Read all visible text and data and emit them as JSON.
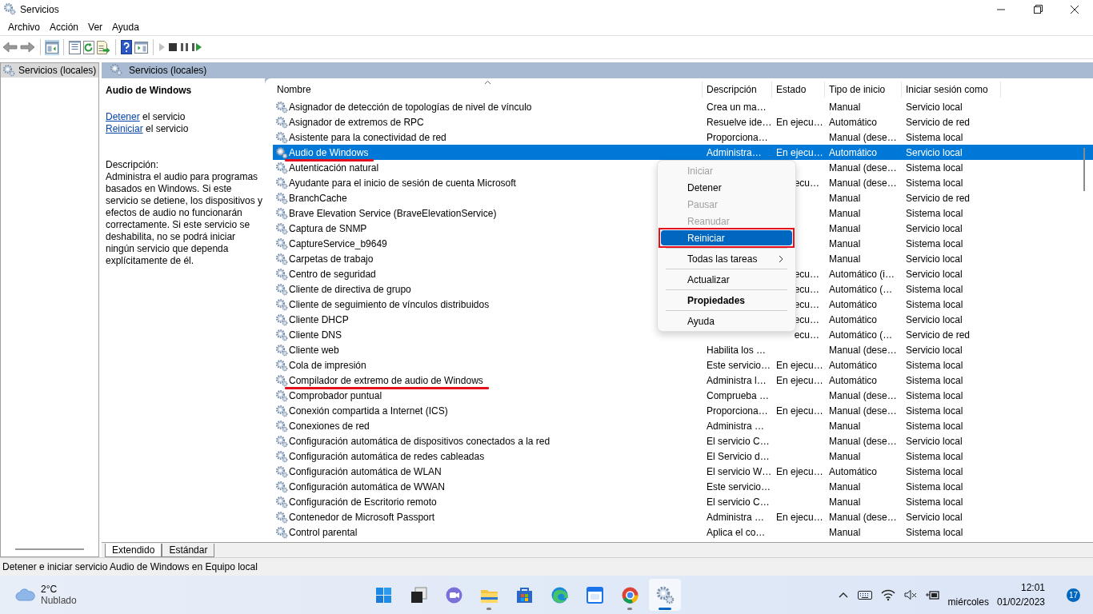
{
  "window": {
    "title": "Servicios"
  },
  "menu": [
    "Archivo",
    "Acción",
    "Ver",
    "Ayuda"
  ],
  "toolbar": [
    {
      "kind": "back",
      "disabled": false,
      "pressed": false
    },
    {
      "kind": "forward",
      "disabled": false,
      "pressed": false
    },
    {
      "kind": "separator"
    },
    {
      "kind": "tree",
      "disabled": false,
      "pressed": true
    },
    {
      "kind": "separator"
    },
    {
      "kind": "properties",
      "disabled": false,
      "pressed": false
    },
    {
      "kind": "refresh",
      "disabled": false,
      "pressed": false
    },
    {
      "kind": "export",
      "disabled": false,
      "pressed": false
    },
    {
      "kind": "separator"
    },
    {
      "kind": "help",
      "disabled": false,
      "pressed": false
    },
    {
      "kind": "actionpane",
      "disabled": false,
      "pressed": false
    },
    {
      "kind": "separator"
    },
    {
      "kind": "play",
      "disabled": true,
      "pressed": false
    },
    {
      "kind": "stop",
      "disabled": false,
      "pressed": false
    },
    {
      "kind": "pause",
      "disabled": false,
      "pressed": false
    },
    {
      "kind": "restart",
      "disabled": false,
      "pressed": false
    }
  ],
  "tree": [
    {
      "label": "Servicios (locales)",
      "selected": true
    }
  ],
  "pane_header": "Servicios (locales)",
  "details": {
    "title": "Audio de Windows",
    "actions": [
      {
        "link": "Detener",
        "text": "el servicio"
      },
      {
        "link": "Reiniciar",
        "text": "el servicio"
      }
    ],
    "description_label": "Descripción:",
    "description": "Administra el audio para programas basados en Windows. Si este servicio se detiene, los dispositivos y efectos de audio no funcionarán correctamente. Si este servicio se deshabilita, no se podrá iniciar ningún servicio que dependa explícitamente de él."
  },
  "table": {
    "columns": [
      {
        "label": "Nombre",
        "sorted": true
      },
      {
        "label": "Descripción",
        "sorted": false
      },
      {
        "label": "Estado",
        "sorted": false
      },
      {
        "label": "Tipo de inicio",
        "sorted": false
      },
      {
        "label": "Iniciar sesión como",
        "sorted": false
      }
    ],
    "rows": [
      {
        "name": "Asignador de detección de topologías de nivel de vínculo",
        "description": "Crea un ma…",
        "startup_type": "Manual",
        "log_on_as": "Servicio local",
        "selected": false,
        "underlined": false,
        "status_covered": false
      },
      {
        "name": "Asignador de extremos de RPC",
        "description": "Resuelve ide…",
        "status": "En ejecu…",
        "startup_type": "Automático",
        "log_on_as": "Servicio de red",
        "selected": false,
        "underlined": false,
        "status_covered": false
      },
      {
        "name": "Asistente para la conectividad de red",
        "description": "Proporciona…",
        "startup_type": "Manual (dese…",
        "log_on_as": "Sistema local",
        "selected": false,
        "underlined": false,
        "status_covered": false
      },
      {
        "name": "Audio de Windows",
        "description": "Administra…",
        "status": "En ejecu…",
        "startup_type": "Automático",
        "log_on_as": "Servicio local",
        "selected": true,
        "underlined": true,
        "status_covered": false
      },
      {
        "name": "Autenticación natural",
        "startup_type": "Manual (dese…",
        "log_on_as": "Sistema local",
        "selected": false,
        "underlined": false,
        "status_covered": false
      },
      {
        "name": "Ayudante para el inicio de sesión de cuenta Microsoft",
        "status": "ecu…",
        "startup_type": "Manual (dese…",
        "log_on_as": "Sistema local",
        "selected": false,
        "underlined": false,
        "status_covered": true
      },
      {
        "name": "BranchCache",
        "startup_type": "Manual",
        "log_on_as": "Servicio de red",
        "selected": false,
        "underlined": false,
        "status_covered": false
      },
      {
        "name": "Brave Elevation Service (BraveElevationService)",
        "startup_type": "Manual",
        "log_on_as": "Sistema local",
        "selected": false,
        "underlined": false,
        "status_covered": false
      },
      {
        "name": "Captura de SNMP",
        "startup_type": "Manual",
        "log_on_as": "Servicio local",
        "selected": false,
        "underlined": false,
        "status_covered": false
      },
      {
        "name": "CaptureService_b9649",
        "startup_type": "Manual",
        "log_on_as": "Sistema local",
        "selected": false,
        "underlined": false,
        "status_covered": false
      },
      {
        "name": "Carpetas de trabajo",
        "startup_type": "Manual",
        "log_on_as": "Servicio local",
        "selected": false,
        "underlined": false,
        "status_covered": false
      },
      {
        "name": "Centro de seguridad",
        "status": "ecu…",
        "startup_type": "Automático (i…",
        "log_on_as": "Servicio local",
        "selected": false,
        "underlined": false,
        "status_covered": true
      },
      {
        "name": "Cliente de directiva de grupo",
        "status": "ecu…",
        "startup_type": "Automático (…",
        "log_on_as": "Sistema local",
        "selected": false,
        "underlined": false,
        "status_covered": true
      },
      {
        "name": "Cliente de seguimiento de vínculos distribuidos",
        "status": "ecu…",
        "startup_type": "Automático",
        "log_on_as": "Sistema local",
        "selected": false,
        "underlined": false,
        "status_covered": true
      },
      {
        "name": "Cliente DHCP",
        "status": "ecu…",
        "startup_type": "Automático",
        "log_on_as": "Servicio local",
        "selected": false,
        "underlined": false,
        "status_covered": true
      },
      {
        "name": "Cliente DNS",
        "status": "ecu…",
        "startup_type": "Automático (…",
        "log_on_as": "Servicio de red",
        "selected": false,
        "underlined": false,
        "status_covered": true
      },
      {
        "name": "Cliente web",
        "description": "Habilita los …",
        "startup_type": "Manual (dese…",
        "log_on_as": "Servicio local",
        "selected": false,
        "underlined": false,
        "status_covered": false
      },
      {
        "name": "Cola de impresión",
        "description": "Este servicio…",
        "status": "En ejecu…",
        "startup_type": "Automático",
        "log_on_as": "Sistema local",
        "selected": false,
        "underlined": false,
        "status_covered": false
      },
      {
        "name": "Compilador de extremo de audio de Windows",
        "description": "Administra l…",
        "status": "En ejecu…",
        "startup_type": "Automático",
        "log_on_as": "Sistema local",
        "selected": false,
        "underlined": true,
        "status_covered": false
      },
      {
        "name": "Comprobador puntual",
        "description": "Comprueba …",
        "startup_type": "Manual (dese…",
        "log_on_as": "Sistema local",
        "selected": false,
        "underlined": false,
        "status_covered": false
      },
      {
        "name": "Conexión compartida a Internet (ICS)",
        "description": "Proporciona…",
        "status": "En ejecu…",
        "startup_type": "Manual (dese…",
        "log_on_as": "Sistema local",
        "selected": false,
        "underlined": false,
        "status_covered": false
      },
      {
        "name": "Conexiones de red",
        "description": "Administra …",
        "startup_type": "Manual",
        "log_on_as": "Sistema local",
        "selected": false,
        "underlined": false,
        "status_covered": false
      },
      {
        "name": "Configuración automática de dispositivos conectados a la red",
        "description": "El servicio C…",
        "startup_type": "Manual (dese…",
        "log_on_as": "Servicio local",
        "selected": false,
        "underlined": false,
        "status_covered": false
      },
      {
        "name": "Configuración automática de redes cableadas",
        "description": "El Servicio d…",
        "startup_type": "Manual",
        "log_on_as": "Sistema local",
        "selected": false,
        "underlined": false,
        "status_covered": false
      },
      {
        "name": "Configuración automática de WLAN",
        "description": "El servicio W…",
        "status": "En ejecu…",
        "startup_type": "Automático",
        "log_on_as": "Sistema local",
        "selected": false,
        "underlined": false,
        "status_covered": false
      },
      {
        "name": "Configuración automática de WWAN",
        "description": "Este servicio…",
        "startup_type": "Manual",
        "log_on_as": "Sistema local",
        "selected": false,
        "underlined": false,
        "status_covered": false
      },
      {
        "name": "Configuración de Escritorio remoto",
        "description": "El servicio C…",
        "startup_type": "Manual",
        "log_on_as": "Sistema local",
        "selected": false,
        "underlined": false,
        "status_covered": false
      },
      {
        "name": "Contenedor de Microsoft Passport",
        "description": "Administra …",
        "status": "En ejecu…",
        "startup_type": "Manual (dese…",
        "log_on_as": "Servicio local",
        "selected": false,
        "underlined": false,
        "status_covered": false
      },
      {
        "name": "Control parental",
        "description": "Aplica el co…",
        "startup_type": "Manual",
        "log_on_as": "Sistema local",
        "selected": false,
        "underlined": false,
        "status_covered": false
      }
    ]
  },
  "context_menu": {
    "items": [
      {
        "kind": "item",
        "label": "Iniciar",
        "disabled": true,
        "hovered": false,
        "highlighted": false,
        "bold": false,
        "submenu": false
      },
      {
        "kind": "item",
        "label": "Detener",
        "disabled": false,
        "hovered": false,
        "highlighted": false,
        "bold": false,
        "submenu": false
      },
      {
        "kind": "item",
        "label": "Pausar",
        "disabled": true,
        "hovered": false,
        "highlighted": false,
        "bold": false,
        "submenu": false
      },
      {
        "kind": "item",
        "label": "Reanudar",
        "disabled": true,
        "hovered": false,
        "highlighted": false,
        "bold": false,
        "submenu": false
      },
      {
        "kind": "item",
        "label": "Reiniciar",
        "disabled": false,
        "hovered": true,
        "highlighted": true,
        "bold": false,
        "submenu": false
      },
      {
        "kind": "separator"
      },
      {
        "kind": "item",
        "label": "Todas las tareas",
        "disabled": false,
        "hovered": false,
        "highlighted": false,
        "bold": false,
        "submenu": true
      },
      {
        "kind": "separator"
      },
      {
        "kind": "item",
        "label": "Actualizar",
        "disabled": false,
        "hovered": false,
        "highlighted": false,
        "bold": false,
        "submenu": false
      },
      {
        "kind": "separator"
      },
      {
        "kind": "item",
        "label": "Propiedades",
        "disabled": false,
        "hovered": false,
        "highlighted": false,
        "bold": true,
        "submenu": false
      },
      {
        "kind": "separator"
      },
      {
        "kind": "item",
        "label": "Ayuda",
        "disabled": false,
        "hovered": false,
        "highlighted": false,
        "bold": false,
        "submenu": false
      }
    ]
  },
  "tabs": [
    {
      "label": "Extendido",
      "selected": true
    },
    {
      "label": "Estándar",
      "selected": false
    }
  ],
  "status_bar": "Detener e iniciar servicio Audio de Windows en Equipo local",
  "taskbar": {
    "weather": {
      "temperature": "2°C",
      "condition": "Nublado"
    },
    "apps": [
      {
        "kind": "start",
        "running": false,
        "active": false
      },
      {
        "kind": "taskview",
        "running": false,
        "active": false
      },
      {
        "kind": "chat",
        "running": false,
        "active": false
      },
      {
        "kind": "explorer",
        "running": true,
        "active": false
      },
      {
        "kind": "store",
        "running": false,
        "active": false
      },
      {
        "kind": "edge",
        "running": false,
        "active": false
      },
      {
        "kind": "calendar",
        "running": false,
        "active": false
      },
      {
        "kind": "chrome",
        "running": true,
        "active": false
      },
      {
        "kind": "services",
        "running": true,
        "active": true
      }
    ],
    "time": "12:01",
    "day": "miércoles",
    "date": "01/02/2023",
    "notifications": "17"
  }
}
